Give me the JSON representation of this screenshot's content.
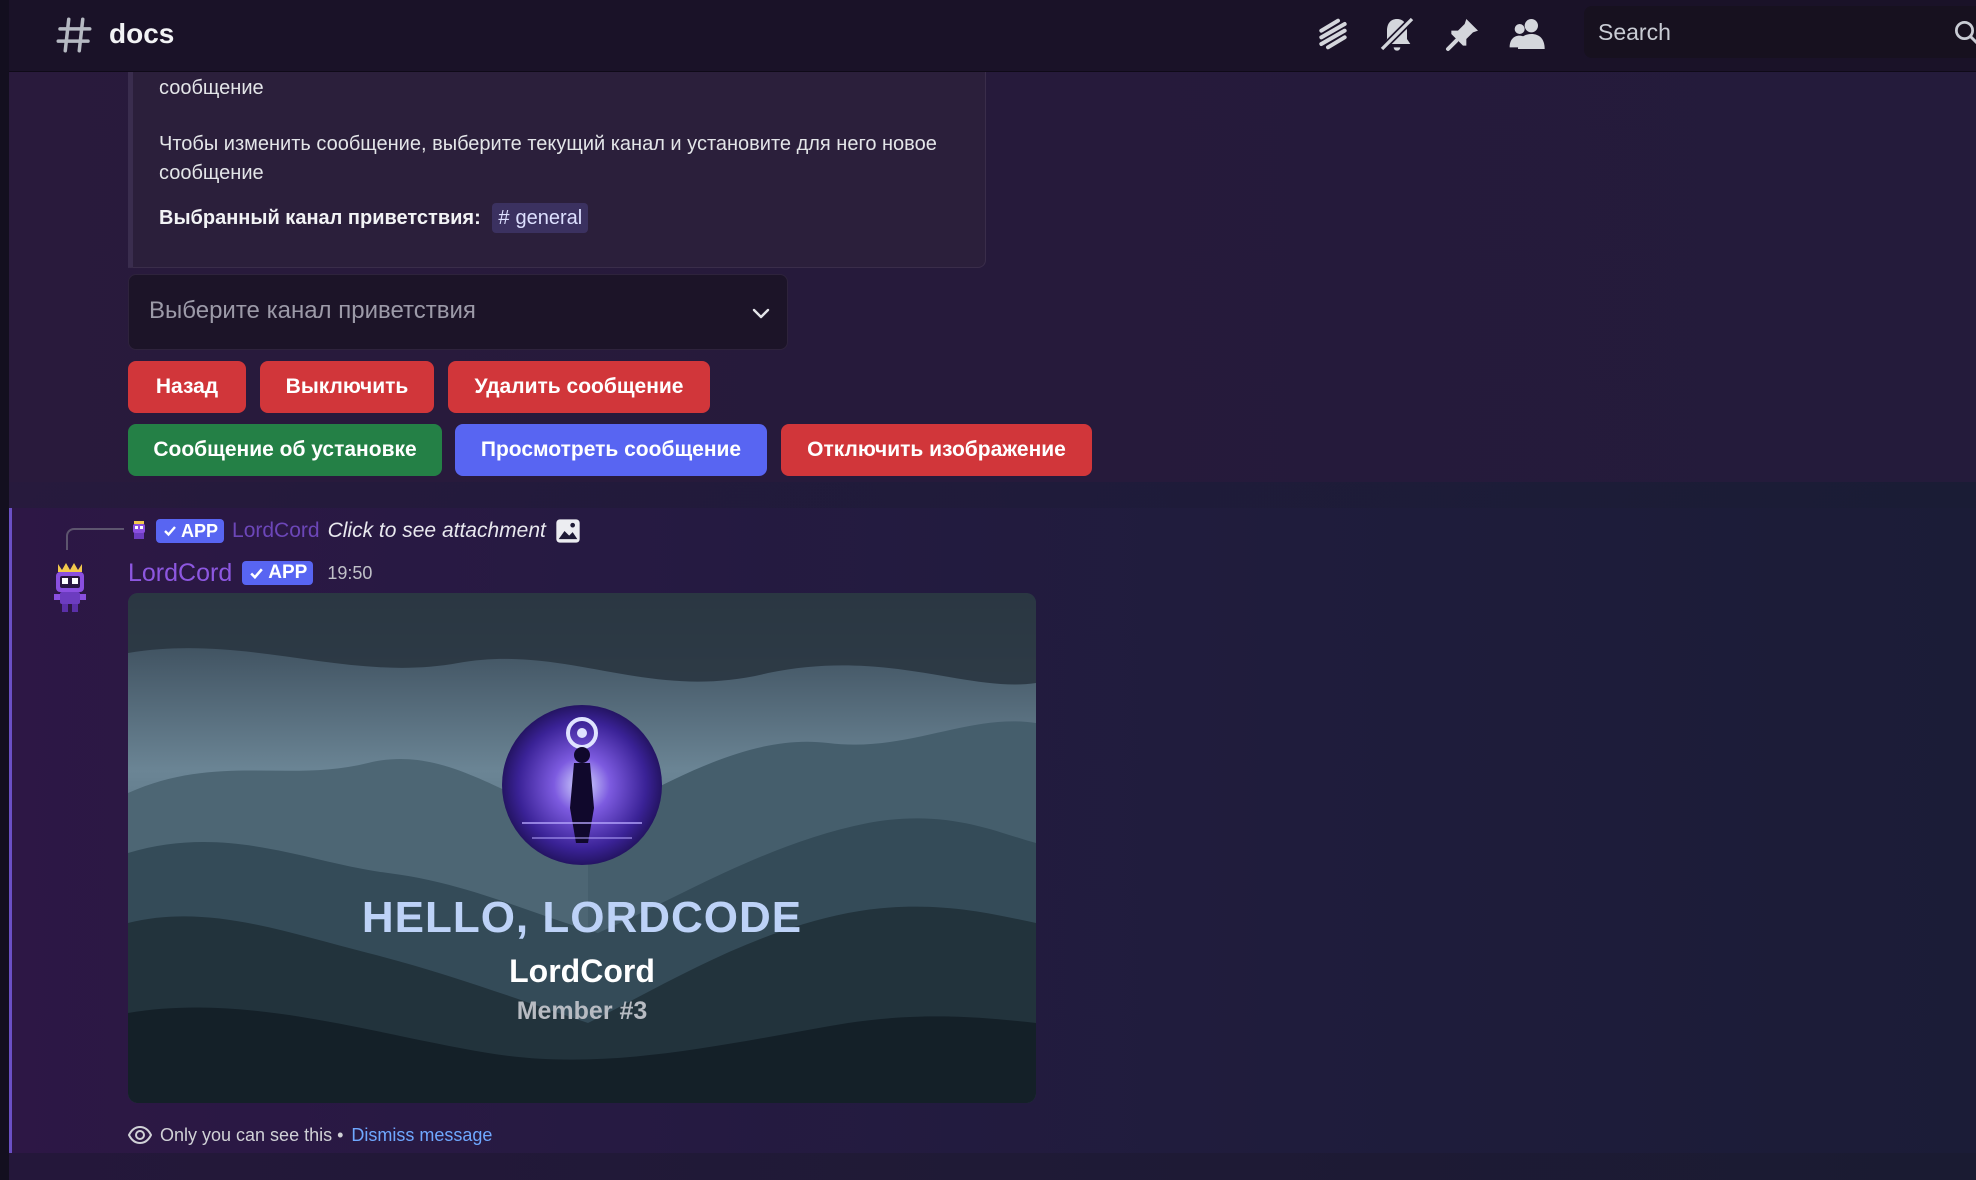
{
  "header": {
    "channel_name": "docs",
    "search_placeholder": "Search"
  },
  "embed": {
    "line1": "сообщение",
    "para2": "Чтобы изменить сообщение, выберите текущий канал и установите для него новое сообщение",
    "selected_label": "Выбранный канал приветствия:",
    "selected_channel": "general"
  },
  "select": {
    "placeholder": "Выберите канал приветствия"
  },
  "buttons": {
    "back": "Назад",
    "disable": "Выключить",
    "delete_message": "Удалить сообщение",
    "setup_message": "Сообщение об установке",
    "view_message": "Просмотреть сообщение",
    "disable_image": "Отключить изображение"
  },
  "reply": {
    "app_tag": "APP",
    "username": "LordCord",
    "text": "Click to see attachment"
  },
  "message": {
    "author": "LordCord",
    "app_tag": "APP",
    "timestamp": "19:50"
  },
  "welcome_card": {
    "title": "HELLO, LORDCODE",
    "name": "LordCord",
    "member": "Member #3"
  },
  "ephemeral": {
    "notice": "Only you can see this •",
    "dismiss": "Dismiss message"
  },
  "colors": {
    "danger": "#d1363a",
    "success": "#248046",
    "primary": "#5865f2",
    "author": "#8d57e0"
  }
}
